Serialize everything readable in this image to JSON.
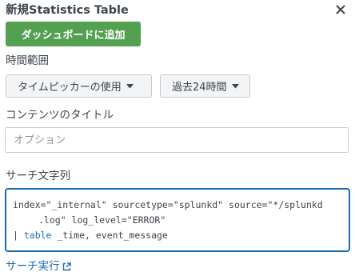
{
  "dialog": {
    "title": "新規Statistics Table",
    "close_icon": "close-icon"
  },
  "actions": {
    "add_to_dashboard_label": "ダッシュボードに追加",
    "add_to_dashboard_color": "#53a051"
  },
  "time_range": {
    "label": "時間範囲",
    "picker_label": "タイムピッカーの使用",
    "preset_label": "過去24時間"
  },
  "content_title": {
    "label": "コンテンツのタイトル",
    "placeholder": "オプション",
    "value": ""
  },
  "search_string": {
    "label": "サーチ文字列",
    "line1": "index=\"_internal\" sourcetype=\"splunkd\" source=\"*/splunkd",
    "line2": ".log\" log_level=\"ERROR\"",
    "line3_pipe": "| ",
    "line3_command": "table",
    "line3_rest": " _time, event_message",
    "focus_color": "#1a6ab6"
  },
  "run_search": {
    "label": "サーチ実行",
    "icon": "external-link-icon"
  }
}
